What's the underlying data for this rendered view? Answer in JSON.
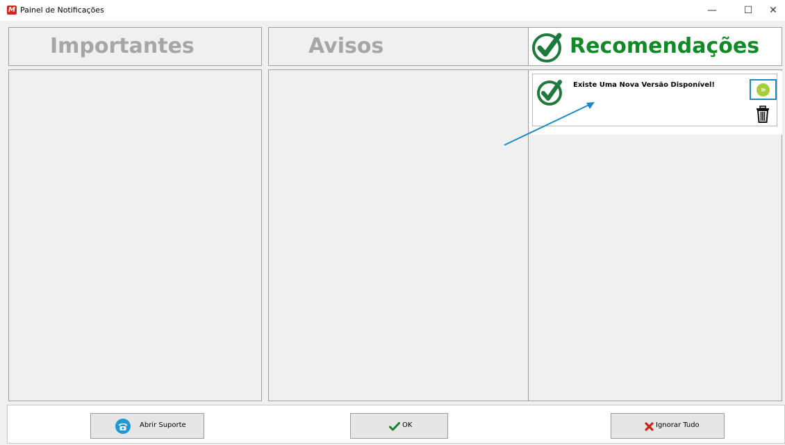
{
  "window": {
    "title": "Painel de Notificações",
    "logo_letter": "M",
    "controls": {
      "minimize": "—",
      "maximize": "☐",
      "close": "✕"
    }
  },
  "columns": [
    {
      "title": "Importantes",
      "active": false
    },
    {
      "title": "Avisos",
      "active": false
    },
    {
      "title": "Recomendações",
      "active": true,
      "icon": "check-circle-icon"
    }
  ],
  "recommendation": {
    "text": "Existe Uma Nova Versão Disponível!",
    "icons": [
      "check-circle-icon",
      "double-chevron-right-icon",
      "trash-icon"
    ],
    "go_glyph": "»"
  },
  "footer": {
    "support_label": "Abrir Suporte",
    "ok_label": "OK",
    "ignore_label": "Ignorar Tudo"
  },
  "colors": {
    "accent_green": "#0f8a24",
    "check_icon_green": "#1e7a3c",
    "annotation_blue": "#1e88c7",
    "go_green": "#a6ce3a",
    "support_blue": "#1b9ad6",
    "ignore_red": "#c8251b",
    "inactive_title": "#a6a6a6"
  }
}
